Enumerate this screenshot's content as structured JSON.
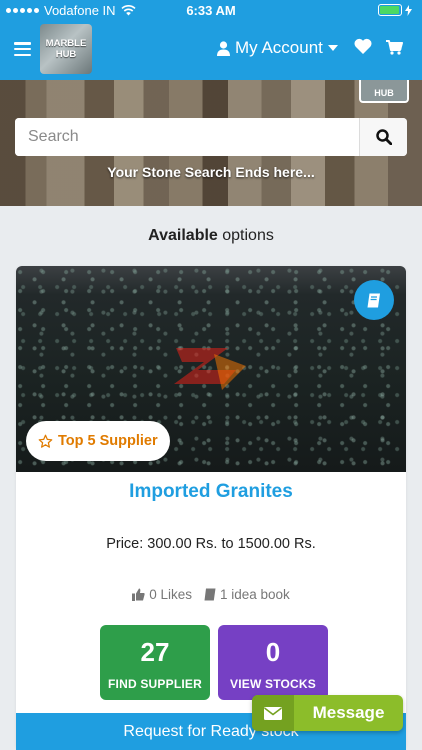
{
  "status_bar": {
    "carrier": "Vodafone IN",
    "time": "6:33 AM",
    "battery_level": 0.95
  },
  "header": {
    "logo_line1": "MARBLE",
    "logo_line2": "HUB",
    "account_label": "My Account",
    "icons": [
      "menu-icon",
      "user-icon",
      "caret-down-icon",
      "heart-icon",
      "cart-icon"
    ],
    "color": "#1f9ee0"
  },
  "hero": {
    "logo_text": "HUB",
    "search_placeholder": "Search",
    "tagline": "Your Stone Search Ends here..."
  },
  "section": {
    "title_bold": "Available",
    "title_rest": " options"
  },
  "product": {
    "badge": "Top 5 Supplier",
    "title": "Imported Granites",
    "price": "Price: 300.00 Rs. to 1500.00 Rs.",
    "likes": "0 Likes",
    "idea_books": "1 idea book",
    "suppliers_count": "27",
    "suppliers_label": "FIND SUPPLIER",
    "stocks_count": "0",
    "stocks_label": "VIEW STOCKS"
  },
  "footer": {
    "ready_stock": "Request for Ready stock",
    "message": "Message"
  },
  "colors": {
    "primary": "#1f9ee0",
    "supplier_green": "#2e9e4a",
    "stocks_purple": "#7640c4",
    "badge_orange": "#e07b00",
    "message_green": "#8cbd2a"
  }
}
